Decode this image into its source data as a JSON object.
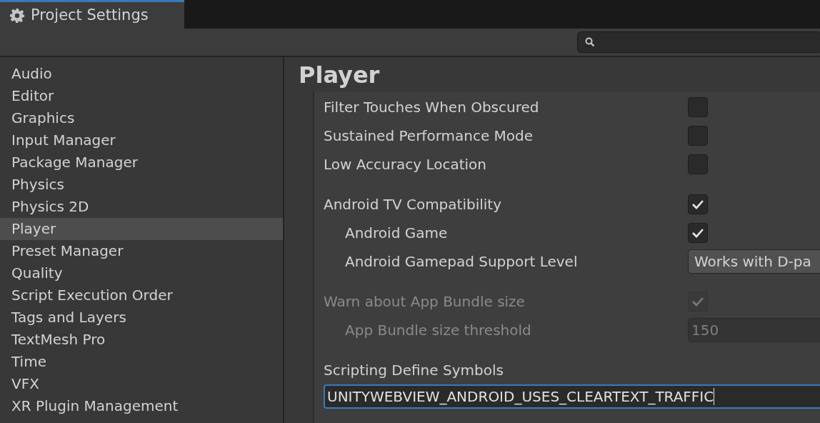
{
  "window": {
    "title": "Project Settings"
  },
  "sidebar": {
    "items": [
      {
        "label": "Audio",
        "selected": false
      },
      {
        "label": "Editor",
        "selected": false
      },
      {
        "label": "Graphics",
        "selected": false
      },
      {
        "label": "Input Manager",
        "selected": false
      },
      {
        "label": "Package Manager",
        "selected": false
      },
      {
        "label": "Physics",
        "selected": false
      },
      {
        "label": "Physics 2D",
        "selected": false
      },
      {
        "label": "Player",
        "selected": true
      },
      {
        "label": "Preset Manager",
        "selected": false
      },
      {
        "label": "Quality",
        "selected": false
      },
      {
        "label": "Script Execution Order",
        "selected": false
      },
      {
        "label": "Tags and Layers",
        "selected": false
      },
      {
        "label": "TextMesh Pro",
        "selected": false
      },
      {
        "label": "Time",
        "selected": false
      },
      {
        "label": "VFX",
        "selected": false
      },
      {
        "label": "XR Plugin Management",
        "selected": false
      }
    ]
  },
  "panel": {
    "title": "Player",
    "groups": [
      [
        {
          "kind": "checkbox",
          "label": "Filter Touches When Obscured",
          "checked": false,
          "disabled": false
        },
        {
          "kind": "checkbox",
          "label": "Sustained Performance Mode",
          "checked": false,
          "disabled": false
        },
        {
          "kind": "checkbox",
          "label": "Low Accuracy Location",
          "checked": false,
          "disabled": false
        }
      ],
      [
        {
          "kind": "checkbox",
          "label": "Android TV Compatibility",
          "checked": true,
          "disabled": false,
          "children": [
            {
              "kind": "checkbox",
              "label": "Android Game",
              "checked": true,
              "disabled": false
            },
            {
              "kind": "dropdown",
              "label": "Android Gamepad Support Level",
              "value": "Works with D-pa"
            }
          ]
        }
      ],
      [
        {
          "kind": "checkbox",
          "label": "Warn about App Bundle size",
          "checked": true,
          "disabled": true,
          "children": [
            {
              "kind": "number",
              "label": "App Bundle size threshold",
              "value": "150",
              "disabled": true
            }
          ]
        }
      ],
      [
        {
          "kind": "text",
          "label": "Scripting Define Symbols",
          "value": "UNITYWEBVIEW_ANDROID_USES_CLEARTEXT_TRAFFIC",
          "focused": true
        }
      ]
    ]
  }
}
